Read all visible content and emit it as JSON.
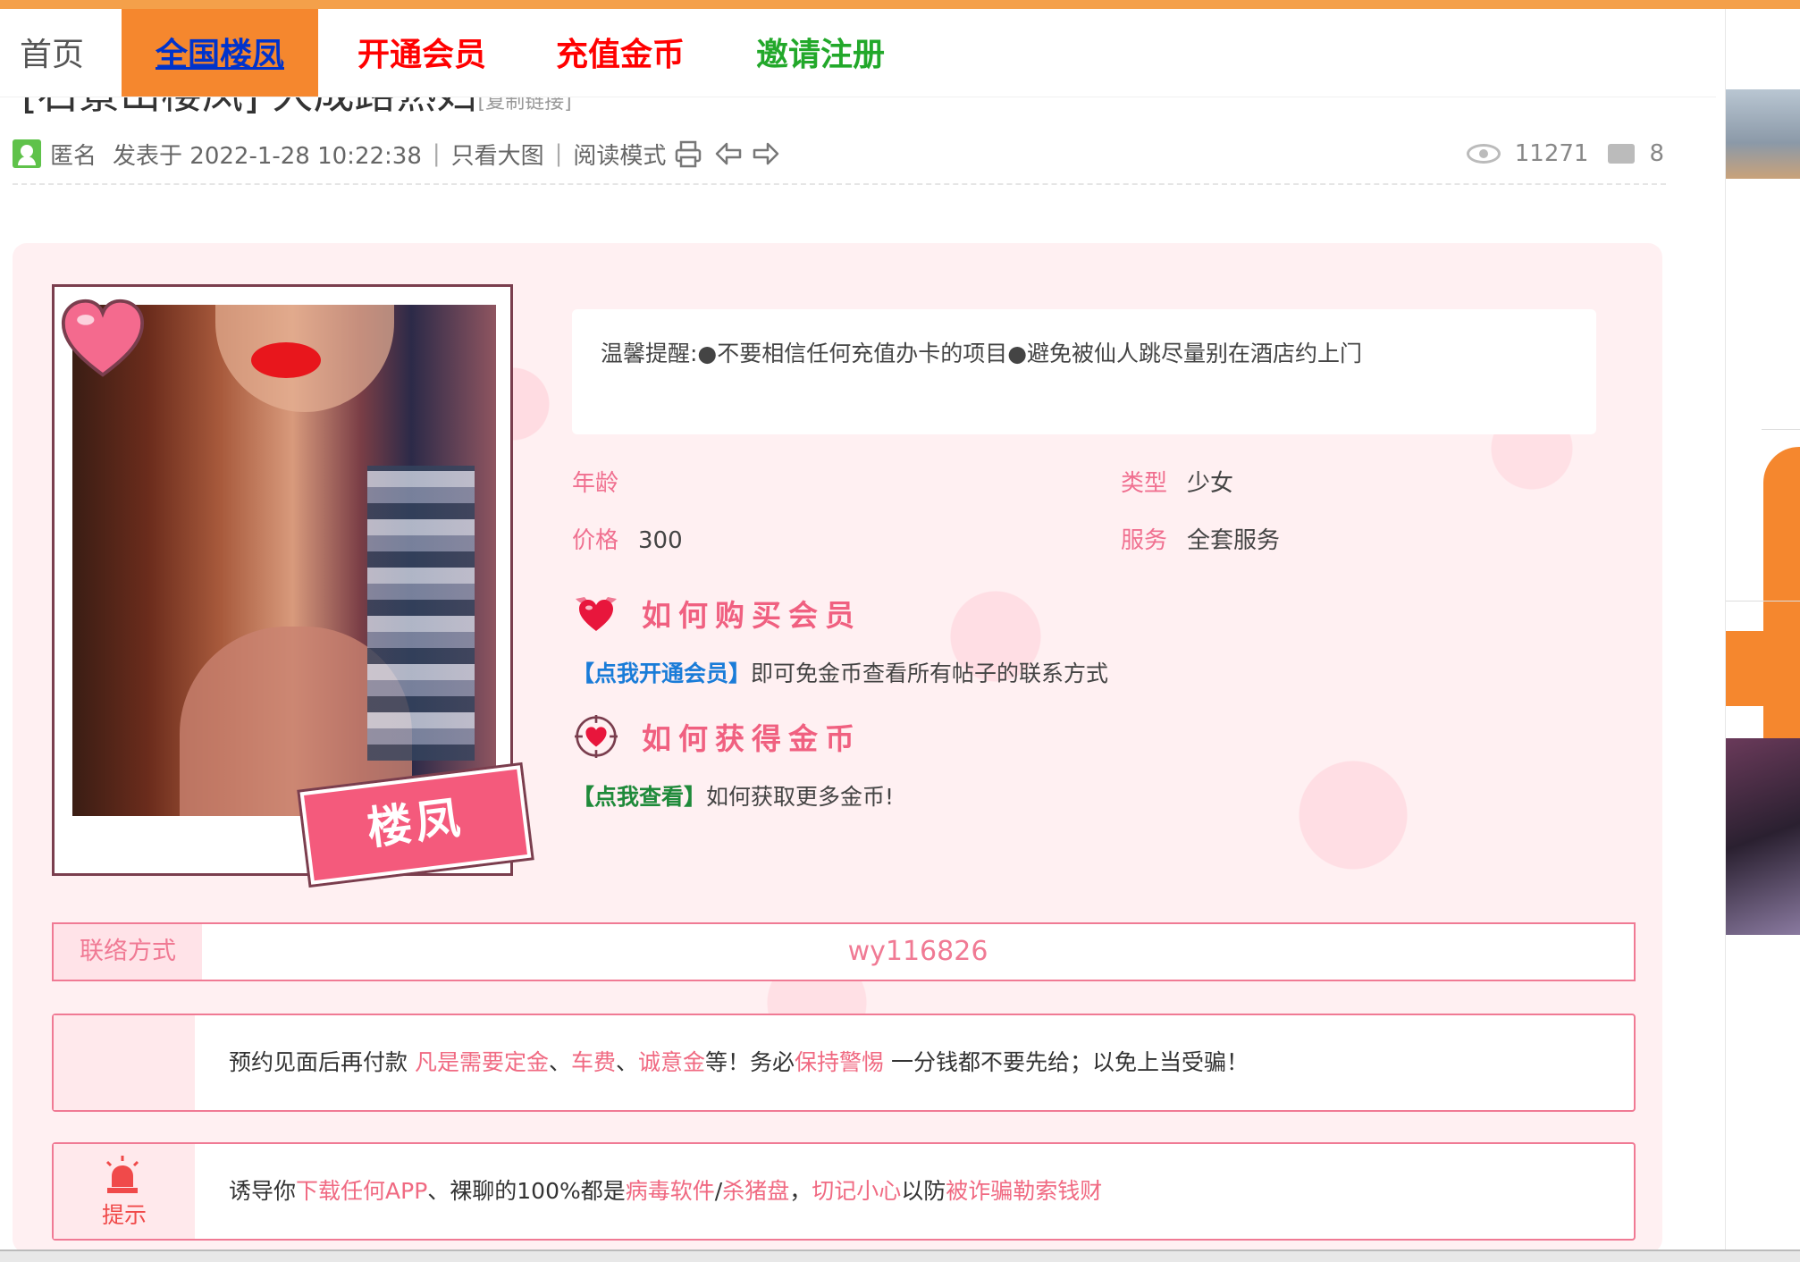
{
  "nav": {
    "home": "首页",
    "items": [
      {
        "label": "全国楼凤",
        "style": "active"
      },
      {
        "label": "开通会员",
        "style": "red"
      },
      {
        "label": "充值金币",
        "style": "red"
      },
      {
        "label": "邀请注册",
        "style": "green"
      }
    ]
  },
  "post": {
    "title": "[石景山楼凤] 大成路熟妇",
    "copy_link": "[复制链接]",
    "author": "匿名",
    "posted": "发表于 2022-1-28 10:22:38",
    "only_images": "只看大图",
    "reading_mode": "阅读模式",
    "views": "11271",
    "replies": "8"
  },
  "photo": {
    "tag": "楼凤"
  },
  "reminder": "温馨提醒:●不要相信任何充值办卡的项目●避免被仙人跳尽量别在酒店约上门",
  "info": {
    "age_label": "年龄",
    "age_value": "",
    "type_label": "类型",
    "type_value": "少女",
    "price_label": "价格",
    "price_value": "300",
    "service_label": "服务",
    "service_value": "全套服务"
  },
  "membership": {
    "title": "如何购买会员",
    "link": "【点我开通会员】",
    "text": "即可免金币查看所有帖子的联系方式"
  },
  "coins": {
    "title": "如何获得金币",
    "link": "【点我查看】",
    "text": "如何获取更多金币!"
  },
  "contact": {
    "label": "联络方式",
    "value": "wy116826"
  },
  "notice1": {
    "p1": "预约见面后再付款 ",
    "h1": "凡是需要定金",
    "p2": "、",
    "h2": "车费",
    "p3": "、",
    "h3": "诚意金",
    "p4": "等！务必",
    "h4": "保持警惕",
    "p5": " 一分钱都不要先给；以免上当受骗！"
  },
  "notice2": {
    "tag": "提示",
    "p1": "诱导你",
    "h1": "下载任何APP",
    "p2": "、裸聊的100%都是",
    "h2": "病毒软件",
    "p3": "/",
    "h3": "杀猪盘",
    "p4": "，",
    "h4": "切记小心",
    "p5": "以防",
    "h5": "被诈骗勒索钱财"
  },
  "colors": {
    "accent": "#f5872e",
    "pink": "#f07a94",
    "nav_red": "#ff0000",
    "nav_green": "#22a82a",
    "link_blue": "#1a7cd8",
    "link_green": "#1f8a3a"
  }
}
